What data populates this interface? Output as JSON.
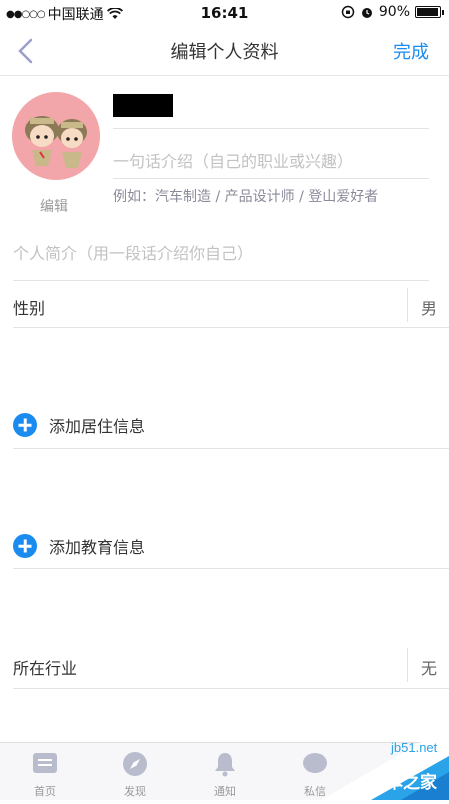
{
  "status_bar": {
    "carrier": "中国联通",
    "time": "16:41",
    "battery": "90%"
  },
  "nav": {
    "title": "编辑个人资料",
    "done": "完成"
  },
  "profile": {
    "avatar_edit": "编辑",
    "intro_placeholder": "一句话介绍（自己的职业或兴趣）",
    "intro_example": "例如：汽车制造 / 产品设计师 / 登山爱好者",
    "bio_placeholder": "个人简介（用一段话介绍你自己）"
  },
  "fields": {
    "gender_label": "性别",
    "gender_value": "男",
    "add_residence": "添加居住信息",
    "add_education": "添加教育信息",
    "industry_label": "所在行业",
    "industry_value": "无"
  },
  "tabbar": {
    "items": [
      {
        "label": "首页",
        "icon": "home-icon"
      },
      {
        "label": "发现",
        "icon": "compass-icon"
      },
      {
        "label": "通知",
        "icon": "bell-icon"
      },
      {
        "label": "私信",
        "icon": "chat-icon"
      }
    ]
  },
  "watermark": {
    "site": "jb51.net",
    "name": "脚本之家"
  }
}
